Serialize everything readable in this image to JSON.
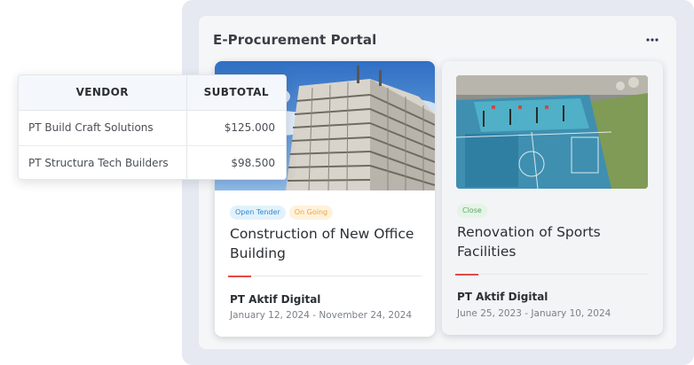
{
  "portal": {
    "title": "E-Procurement Portal",
    "menu_icon": "more-horizontal-icon"
  },
  "vendor_table": {
    "headers": [
      "VENDOR",
      "SUBTOTAL"
    ],
    "rows": [
      {
        "vendor": "PT Build Craft Solutions",
        "subtotal": "$125.000"
      },
      {
        "vendor": "PT Structura Tech Builders",
        "subtotal": "$98.500"
      }
    ]
  },
  "tenders": [
    {
      "badges": [
        {
          "label": "Open Tender",
          "color": "#2a8ad2"
        },
        {
          "label": "On Going",
          "color": "#f2a33a"
        }
      ],
      "title": "Construction of New Office Building",
      "company": "PT Aktif Digital",
      "dates": "January 12, 2024 - November 24, 2024",
      "image": "building-construction-photo"
    },
    {
      "badges": [
        {
          "label": "Close",
          "color": "#5aa867"
        }
      ],
      "title": "Renovation of Sports Facilities",
      "company": "PT Aktif Digital",
      "dates": "June 25, 2023 - January 10, 2024",
      "image": "sports-court-aerial-photo"
    }
  ],
  "colors": {
    "accent_line": "#e24a4a",
    "panel_bg": "#f5f6f8",
    "outer_bg": "#e6e9f1"
  }
}
